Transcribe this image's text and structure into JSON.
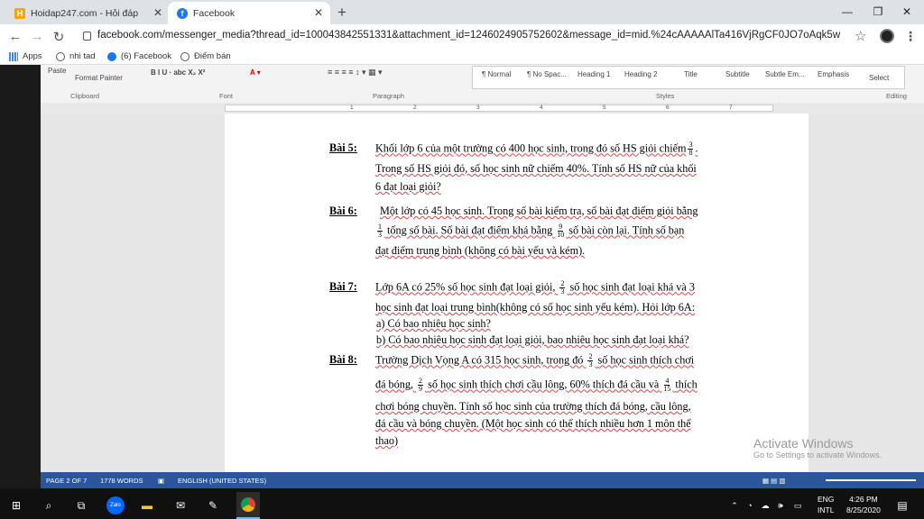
{
  "browser": {
    "tabs": [
      {
        "title": "Hoidap247.com - Hỏi đáp bài tập",
        "favicon_color": "#f6a609"
      },
      {
        "title": "Facebook",
        "favicon_color": "#1877f2"
      }
    ],
    "new_tab": "+",
    "url": "facebook.com/messenger_media?thread_id=100043842551331&attachment_id=1246024905752602&message_id=mid.%24cAAAAAlTa416VjRgCF0JO7oAqk5w",
    "bookmarks": [
      "Apps",
      "nhi tad",
      "(6) Facebook",
      "Điểm bán"
    ]
  },
  "word": {
    "ribbon": {
      "paste": "Paste",
      "format_painter": "Format Painter",
      "font_buttons": "B  I  U  ·  abc  X₂  X²",
      "groups": [
        "Clipboard",
        "Font",
        "Paragraph",
        "Styles",
        "Editing"
      ],
      "styles": [
        "¶ Normal",
        "¶ No Spac...",
        "Heading 1",
        "Heading 2",
        "Title",
        "Subtitle",
        "Subtle Em...",
        "Emphasis"
      ],
      "select": "Select"
    },
    "ruler_numbers": [
      "1",
      "2",
      "3",
      "4",
      "5",
      "6",
      "7"
    ],
    "problems": [
      {
        "label": "Bài 5:"
      },
      {
        "label": "Bài 6:"
      },
      {
        "label": "Bài 7:"
      },
      {
        "label": "Bài 8:"
      }
    ],
    "text": {
      "b5_l1a": "Khối lớp 6 của một trường có 400 học sinh, trong đó số HS giỏi chiếm",
      "b5_l2": "Trong số HS giỏi đó, số học sinh nữ chiếm 40%. Tính số HS nữ của khối",
      "b5_l3": "6 đạt loại giỏi?",
      "b6_l1": "Một lớp có 45 học sinh. Trong số bài kiểm tra, số bài đạt điểm giỏi bằng",
      "b6_l2a": "tổng số bài. Số bài đạt điểm khá bằng",
      "b6_l2b": "số bài còn lại. Tính số bạn",
      "b6_l3": "đạt điểm trung bình (không có bài yếu và kém).",
      "b7_l1a": "Lớp 6A có 25% số học sinh đạt loại giỏi,",
      "b7_l1b": "số học sinh đạt loại khá và 3",
      "b7_l2": "học sinh đạt loại trung bình(không có số học sinh yếu kém). Hỏi lớp 6A:",
      "b7_a": "a)  Có bao nhiêu học sinh?",
      "b7_b": "b)  Có bao nhiêu học sinh đạt loại giỏi, bao nhiêu học sinh đạt loại khá?",
      "b8_l1a": "Trường Dịch Vọng A có 315 học sinh, trong đó",
      "b8_l1b": "số học sinh thích chơi",
      "b8_l2a": "đá bóng,",
      "b8_l2b": "số học sinh thích chơi cầu lông, 60% thích đá cầu và",
      "b8_l2c": "thích",
      "b8_l3": "chơi bóng chuyền. Tính số học sinh của trường thích đá bóng, cầu lông,",
      "b8_l4": "đá cầu và bóng chuyền. (Một học sinh có thể thích nhiều hơn 1 môn thể",
      "b8_l5": "thao)"
    },
    "fractions": {
      "f3_8": [
        "3",
        "8"
      ],
      "f1_3": [
        "1",
        "3"
      ],
      "f9_10": [
        "9",
        "10"
      ],
      "f2_3": [
        "2",
        "3"
      ],
      "f2_9": [
        "2",
        "9"
      ],
      "f4_15": [
        "4",
        "15"
      ]
    },
    "watermark": {
      "title": "Activate Windows",
      "sub": "Go to Settings to activate Windows."
    },
    "status": {
      "page": "PAGE 2 OF 7",
      "words": "1778 WORDS",
      "lang": "ENGLISH (UNITED STATES)"
    }
  },
  "taskbar": {
    "lang1": "ENG",
    "lang2": "INTL",
    "time": "4:26 PM",
    "date": "8/25/2020",
    "zalo": "Zalo"
  }
}
